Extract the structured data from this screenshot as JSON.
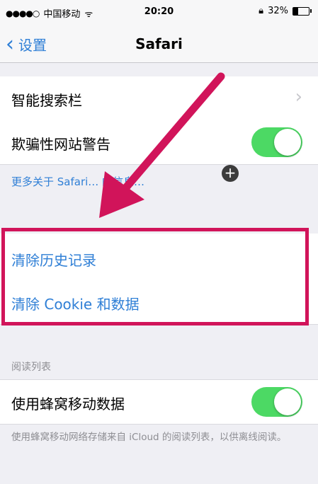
{
  "status_bar": {
    "signal": "●●●●○",
    "carrier": "中国移动",
    "time": "20:20",
    "battery_percent": "32%"
  },
  "nav": {
    "back_label": "设置",
    "title": "Safari"
  },
  "rows": {
    "smart_search": "智能搜索栏",
    "fraud_warning": "欺骗性网站警告",
    "fraud_warning_on": true,
    "more_info": "更多关于 Safari… 的信息…",
    "clear_history": "清除历史记录",
    "clear_cookies": "清除 Cookie 和数据"
  },
  "reading_list": {
    "header": "阅读列表",
    "use_cellular": "使用蜂窝移动数据",
    "use_cellular_on": true,
    "footer": "使用蜂窝移动网络存储来自 iCloud 的阅读列表，以供离线阅读。"
  },
  "colors": {
    "toggle_on": "#4cd964",
    "link_blue": "#2f7fd6",
    "annotation": "#d1145a"
  }
}
